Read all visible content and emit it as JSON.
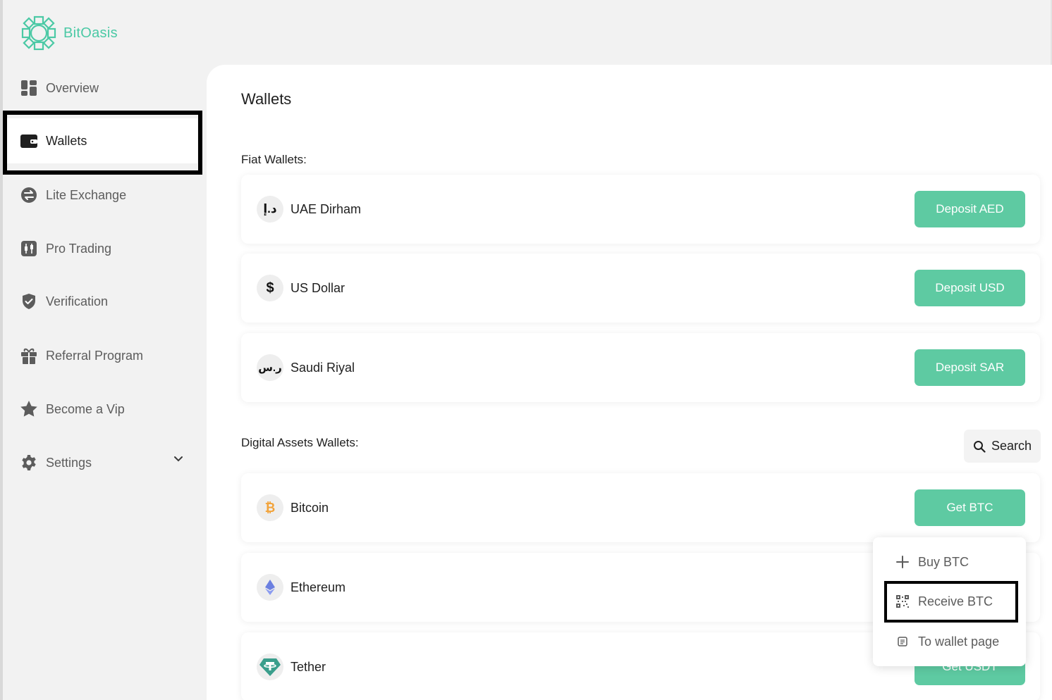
{
  "brand": {
    "name": "BitOasis",
    "color": "#4bc9a5"
  },
  "sidebar": {
    "items": [
      {
        "label": "Overview",
        "icon": "overview-icon"
      },
      {
        "label": "Wallets",
        "icon": "wallet-icon",
        "active": true
      },
      {
        "label": "Lite Exchange",
        "icon": "exchange-icon"
      },
      {
        "label": "Pro Trading",
        "icon": "candlestick-icon"
      },
      {
        "label": "Verification",
        "icon": "shield-check-icon"
      },
      {
        "label": "Referral Program",
        "icon": "gift-icon"
      },
      {
        "label": "Become a Vip",
        "icon": "star-icon"
      },
      {
        "label": "Settings",
        "icon": "gear-icon"
      }
    ]
  },
  "main": {
    "title": "Wallets",
    "fiat_label": "Fiat Wallets:",
    "fiat": [
      {
        "symbol": "د.إ",
        "name": "UAE Dirham",
        "button": "Deposit AED"
      },
      {
        "symbol": "$",
        "name": "US Dollar",
        "button": "Deposit USD"
      },
      {
        "symbol": "ر.س",
        "name": "Saudi Riyal",
        "button": "Deposit SAR"
      }
    ],
    "digital_label": "Digital Assets Wallets:",
    "search_label": "Search",
    "digital": [
      {
        "symbol": "₿",
        "name": "Bitcoin",
        "button": "Get BTC"
      },
      {
        "symbol": "",
        "name": "Ethereum",
        "button": ""
      },
      {
        "symbol": "",
        "name": "Tether",
        "button": "Get USDT"
      }
    ]
  },
  "dropdown": {
    "items": [
      {
        "label": "Buy BTC",
        "icon": "plus-icon"
      },
      {
        "label": "Receive BTC",
        "icon": "qr-code-icon"
      },
      {
        "label": "To wallet page",
        "icon": "document-icon"
      }
    ]
  },
  "colors": {
    "accent": "#5ecaa2",
    "bitcoin": "#f2a33a",
    "ethereum": "#6b7fe0",
    "tether": "#3a9e8c"
  }
}
